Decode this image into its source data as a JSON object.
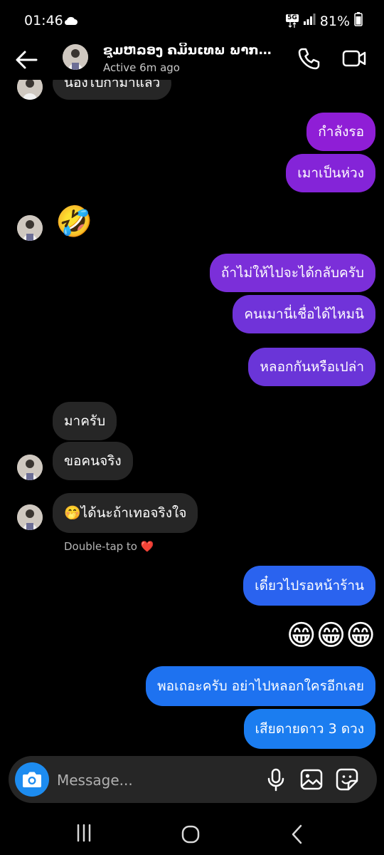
{
  "status_bar": {
    "time": "01:46",
    "network_badge": "5G",
    "battery": "81%"
  },
  "header": {
    "name": "ຊຸມຫລອງ ຄມິນເທພ ພາກຈິຕ...",
    "status": "Active 6m ago"
  },
  "messages": {
    "partial_top": "น้องไปกามาแล้ว",
    "m1": "กำลังรอ",
    "m2": "เมาเป็นห่วง",
    "m3": "🤣",
    "m4": "ถ้าไม่ให้ไปจะได้กลับครับ",
    "m5": "คนเมานี่เชื่อได้ไหมนิ",
    "m6": "หลอกกันหรือเปล่า",
    "m7": "มาครับ",
    "m8": "ขอคนจริง",
    "m9_emoji": "🤭",
    "m9_text": "ได้นะถ้าเทอจริงใจ",
    "m10": "เดี๋ยวไปรอหน้าร้าน",
    "m11": "😁😁😁",
    "m12": "พอเถอะครับ อย่าไปหลอกใครอีกเลย",
    "m13": "เสียดายดาว 3 ดวง"
  },
  "reaction_hint": {
    "text": "Double-tap to",
    "heart": "❤️"
  },
  "composer": {
    "placeholder": "Message..."
  },
  "colors": {
    "outgoing_purple_1": "#8f1ed6",
    "outgoing_purple_2": "#7d2ed9",
    "outgoing_violet": "#6b35d8",
    "outgoing_blue": "#1e6ef0",
    "incoming": "#262626",
    "camera_blue": "#1d8cf0"
  }
}
